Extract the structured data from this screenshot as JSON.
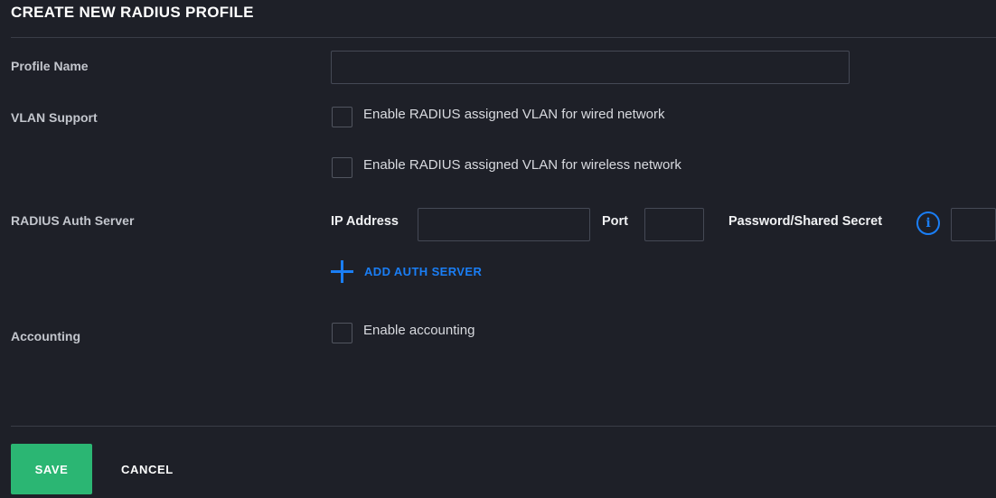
{
  "header": {
    "title": "CREATE NEW RADIUS PROFILE"
  },
  "form": {
    "profile_name": {
      "label": "Profile Name",
      "value": ""
    },
    "vlan_support": {
      "label": "VLAN Support",
      "options": [
        {
          "label": "Enable RADIUS assigned VLAN for wired network",
          "checked": false
        },
        {
          "label": "Enable RADIUS assigned VLAN for wireless network",
          "checked": false
        }
      ]
    },
    "auth_server": {
      "label": "RADIUS Auth Server",
      "ip_label": "IP Address",
      "ip_value": "",
      "port_label": "Port",
      "port_value": "",
      "secret_label": "Password/Shared Secret",
      "secret_value": "",
      "info_icon": "info-icon",
      "add_label": "ADD AUTH SERVER",
      "add_icon": "plus-icon"
    },
    "accounting": {
      "label": "Accounting",
      "option": {
        "label": "Enable accounting",
        "checked": false
      }
    }
  },
  "footer": {
    "save_label": "SAVE",
    "cancel_label": "CANCEL"
  },
  "colors": {
    "background": "#1e2028",
    "accent": "#1a7ef5",
    "save": "#2bb673"
  }
}
